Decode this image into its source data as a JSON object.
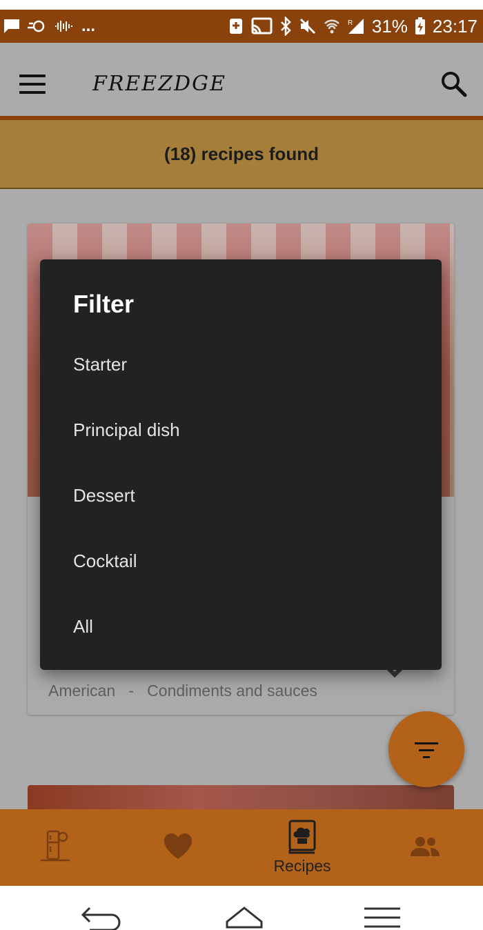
{
  "status_bar": {
    "left_more": "...",
    "battery_percent": "31%",
    "time": "23:17"
  },
  "app_bar": {
    "logo_text": "FREEZDGE"
  },
  "results": {
    "count_text": "(18) recipes found"
  },
  "card": {
    "cuisine": "American",
    "separator": "-",
    "category": "Condiments and sauces"
  },
  "filter_dialog": {
    "title": "Filter",
    "options": [
      "Starter",
      "Principal dish",
      "Dessert",
      "Cocktail",
      "All"
    ]
  },
  "bottom_nav": {
    "items": [
      {
        "icon": "fridge-icon",
        "label": ""
      },
      {
        "icon": "heart-icon",
        "label": ""
      },
      {
        "icon": "recipe-book-icon",
        "label": "Recipes"
      },
      {
        "icon": "people-icon",
        "label": ""
      }
    ]
  },
  "colors": {
    "status_bar": "#8a420c",
    "accent": "#b3621a",
    "banner": "#a57f3a",
    "dialog": "#222222"
  }
}
